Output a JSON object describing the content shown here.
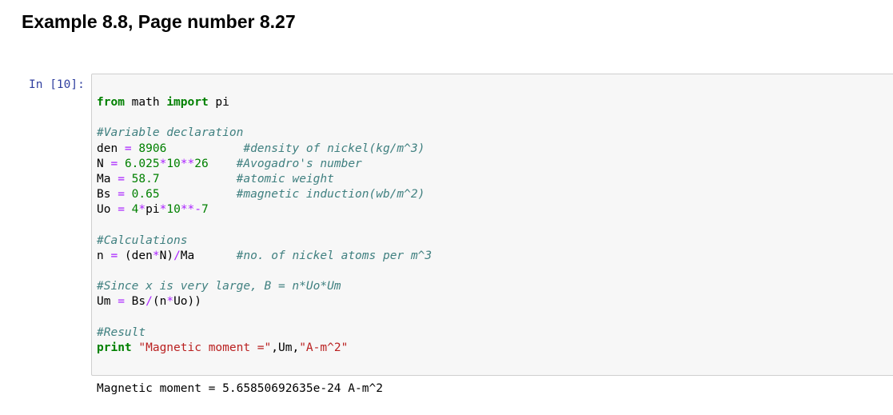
{
  "heading": "Example 8.8, Page number 8.27",
  "cell": {
    "prompt": "In [10]:",
    "code_lines": [
      [
        {
          "t": "kw",
          "v": "from"
        },
        {
          "t": "plain",
          "v": " math "
        },
        {
          "t": "kw",
          "v": "import"
        },
        {
          "t": "plain",
          "v": " pi"
        }
      ],
      [],
      [
        {
          "t": "cm",
          "v": "#Variable declaration"
        }
      ],
      [
        {
          "t": "plain",
          "v": "den "
        },
        {
          "t": "op",
          "v": "="
        },
        {
          "t": "plain",
          "v": " "
        },
        {
          "t": "num",
          "v": "8906"
        },
        {
          "t": "plain",
          "v": "           "
        },
        {
          "t": "cm",
          "v": "#density of nickel(kg/m^3)"
        }
      ],
      [
        {
          "t": "plain",
          "v": "N "
        },
        {
          "t": "op",
          "v": "="
        },
        {
          "t": "plain",
          "v": " "
        },
        {
          "t": "num",
          "v": "6.025"
        },
        {
          "t": "op",
          "v": "*"
        },
        {
          "t": "num",
          "v": "10"
        },
        {
          "t": "op",
          "v": "**"
        },
        {
          "t": "num",
          "v": "26"
        },
        {
          "t": "plain",
          "v": "    "
        },
        {
          "t": "cm",
          "v": "#Avogadro's number"
        }
      ],
      [
        {
          "t": "plain",
          "v": "Ma "
        },
        {
          "t": "op",
          "v": "="
        },
        {
          "t": "plain",
          "v": " "
        },
        {
          "t": "num",
          "v": "58.7"
        },
        {
          "t": "plain",
          "v": "           "
        },
        {
          "t": "cm",
          "v": "#atomic weight"
        }
      ],
      [
        {
          "t": "plain",
          "v": "Bs "
        },
        {
          "t": "op",
          "v": "="
        },
        {
          "t": "plain",
          "v": " "
        },
        {
          "t": "num",
          "v": "0.65"
        },
        {
          "t": "plain",
          "v": "           "
        },
        {
          "t": "cm",
          "v": "#magnetic induction(wb/m^2)"
        }
      ],
      [
        {
          "t": "plain",
          "v": "Uo "
        },
        {
          "t": "op",
          "v": "="
        },
        {
          "t": "plain",
          "v": " "
        },
        {
          "t": "num",
          "v": "4"
        },
        {
          "t": "op",
          "v": "*"
        },
        {
          "t": "plain",
          "v": "pi"
        },
        {
          "t": "op",
          "v": "*"
        },
        {
          "t": "num",
          "v": "10"
        },
        {
          "t": "op",
          "v": "**-"
        },
        {
          "t": "num",
          "v": "7"
        }
      ],
      [],
      [
        {
          "t": "cm",
          "v": "#Calculations"
        }
      ],
      [
        {
          "t": "plain",
          "v": "n "
        },
        {
          "t": "op",
          "v": "="
        },
        {
          "t": "plain",
          "v": " (den"
        },
        {
          "t": "op",
          "v": "*"
        },
        {
          "t": "plain",
          "v": "N)"
        },
        {
          "t": "op",
          "v": "/"
        },
        {
          "t": "plain",
          "v": "Ma      "
        },
        {
          "t": "cm",
          "v": "#no. of nickel atoms per m^3"
        }
      ],
      [],
      [
        {
          "t": "cm",
          "v": "#Since x is very large, B = n*Uo*Um"
        }
      ],
      [
        {
          "t": "plain",
          "v": "Um "
        },
        {
          "t": "op",
          "v": "="
        },
        {
          "t": "plain",
          "v": " Bs"
        },
        {
          "t": "op",
          "v": "/"
        },
        {
          "t": "plain",
          "v": "(n"
        },
        {
          "t": "op",
          "v": "*"
        },
        {
          "t": "plain",
          "v": "Uo))"
        }
      ],
      [],
      [
        {
          "t": "cm",
          "v": "#Result"
        }
      ],
      [
        {
          "t": "kw",
          "v": "print"
        },
        {
          "t": "plain",
          "v": " "
        },
        {
          "t": "str",
          "v": "\"Magnetic moment =\""
        },
        {
          "t": "plain",
          "v": ",Um,"
        },
        {
          "t": "str",
          "v": "\"A-m^2\""
        }
      ]
    ],
    "output": "Magnetic moment = 5.65850692635e-24 A-m^2"
  }
}
